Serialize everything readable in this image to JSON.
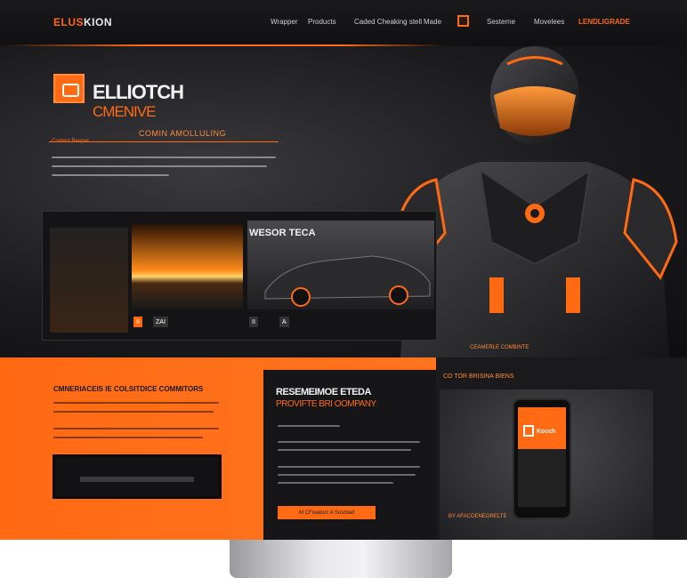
{
  "nav": {
    "brand_part1": "ELUS",
    "brand_part2": "KION",
    "items": [
      "Wrapper",
      "Products",
      "Caded Cheaking stell",
      "Made",
      "Sesterne",
      "Movelees"
    ],
    "cta": "LENDLIGRADE"
  },
  "hero": {
    "title": "ELLIOTCH",
    "subtitle": "CMENIVE",
    "tagline": "COMIN AMOLLULING",
    "label": "Contect Reeper",
    "tagline_right": "CEAMERLE COMBINTE"
  },
  "gallery": {
    "car_title": "WESOR TECA",
    "buttons": [
      "II",
      "ZAI",
      "II",
      "A"
    ]
  },
  "band": {
    "heading": "CMNERIACEIS IE COLSITDICE COMMITORS"
  },
  "card": {
    "title": "RESEMEIMOE ETEDA",
    "subtitle": "PROVIFTE BRI OOMPANY",
    "button": "M CFreaturc A Sosntad"
  },
  "right_panel": {
    "label": "CO TOR BRISINA BIENS",
    "phone_text": "Kocch",
    "caption": "BY AFACOENEORELTE"
  },
  "colors": {
    "accent": "#ff6a13",
    "dark": "#0b0b0d",
    "text_light": "#f2f2f2"
  }
}
